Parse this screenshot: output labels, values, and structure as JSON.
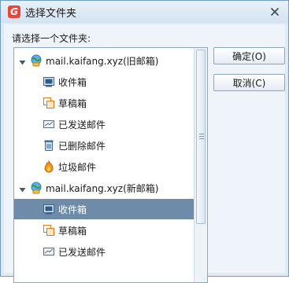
{
  "window": {
    "title": "选择文件夹",
    "accent": "#e8463a"
  },
  "prompt": "请选择一个文件夹:",
  "tree": [
    {
      "kind": "account",
      "label": "mail.kaifang.xyz(旧邮箱)",
      "icon": "account-globe-icon",
      "expanded": true
    },
    {
      "kind": "folder",
      "label": "收件箱",
      "icon": "inbox-icon"
    },
    {
      "kind": "folder",
      "label": "草稿箱",
      "icon": "drafts-icon"
    },
    {
      "kind": "folder",
      "label": "已发送邮件",
      "icon": "sent-icon"
    },
    {
      "kind": "folder",
      "label": "已删除邮件",
      "icon": "deleted-icon"
    },
    {
      "kind": "folder",
      "label": "垃圾邮件",
      "icon": "junk-icon"
    },
    {
      "kind": "account",
      "label": "mail.kaifang.xyz(新邮箱)",
      "icon": "account-globe-icon",
      "expanded": true
    },
    {
      "kind": "folder",
      "label": "收件箱",
      "icon": "inbox-icon",
      "selected": true
    },
    {
      "kind": "folder",
      "label": "草稿箱",
      "icon": "drafts-icon"
    },
    {
      "kind": "folder",
      "label": "已发送邮件",
      "icon": "sent-icon"
    }
  ],
  "buttons": {
    "ok": "确定(O)",
    "cancel": "取消(C)"
  },
  "colors": {
    "selection": "#6e8caa",
    "border": "#8aa8c6"
  }
}
